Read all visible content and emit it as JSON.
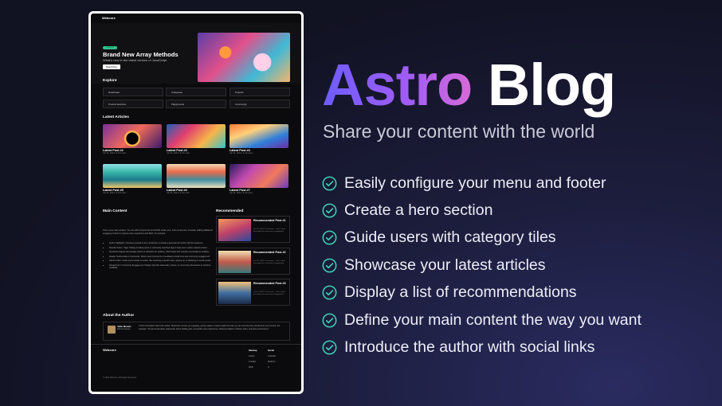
{
  "hero": {
    "title_part1": "Astro",
    "title_part2": "Blog",
    "subtitle": "Share your content with the world",
    "accent_gradient": [
      "#6d5cff",
      "#a35cf3",
      "#d66bd8"
    ],
    "check_color": "#3fd0b4"
  },
  "features": [
    "Easily configure your menu and footer",
    "Create a hero section",
    "Guide users with category tiles",
    "Showcase your latest articles",
    "Display a list of recommendations",
    "Define your main content the way you want",
    "Introduce the author with social links"
  ],
  "preview": {
    "site_name": "Webcore",
    "hero": {
      "badge": "Featured",
      "title": "Brand New Array Methods",
      "subtitle": "What's new in the latest version of JavaScript",
      "button": "Read More"
    },
    "explore": {
      "title": "Explore",
      "tiles": [
        "Roadmaps",
        "Categories",
        "Projects",
        "Product launches",
        "Playgrounds",
        "Community"
      ]
    },
    "latest": {
      "title": "Latest Articles",
      "posts": [
        {
          "title": "Latest Post #2",
          "meta": "Jan 01, 2024 • 5 min read"
        },
        {
          "title": "Latest Post #3",
          "meta": "Jan 01, 2024 • 5 min read"
        },
        {
          "title": "Latest Post #4",
          "meta": "Jan 01, 2024 • 4 min read"
        },
        {
          "title": "Latest Post #5",
          "meta": "Jan 01, 2024 • 5 min read"
        },
        {
          "title": "Latest Post #6",
          "meta": "Jan 01, 2024 • 4 min read"
        },
        {
          "title": "Latest Post #7",
          "meta": "Jan 01, 2024 • 5 min read"
        }
      ]
    },
    "main": {
      "title": "Main Content",
      "intro": "This is your main content. You can add components and HTML inside your .mdx component. Consider adding additional engaging content to improve user experience and SEO, for example:",
      "items": [
        "Author Highlights: Introduce yourself or key contributors to create a personal connection with the audience.",
        "Popular Topics / Tags: Display trending topics or commonly searched tags to help users explore related content.",
        "Newsletter Signup: Encourage visitors to subscribe for updates, which helps with retention and audience building.",
        "Reader Testimonials or Comments: Show recent comments or feedback to build trust and community engagement.",
        "Call-to-Action: Guide users toward an action, like exploring a specific topic, signing up, or following on social media.",
        "Social Proof / Community Engagement: Display stats like total reads, shares, or community discussions to reinforce credibility."
      ]
    },
    "recommended": {
      "title": "Recommended",
      "items": [
        {
          "title": "Recommended Post #1",
          "meta": "Jan 01, 2024 • 5 min read — Just a short description for some extra engagement."
        },
        {
          "title": "Recommended Post #2",
          "meta": "Jan 01, 2024 • 5 min read — Just a short description for some extra engagement."
        },
        {
          "title": "Recommended Post #3",
          "meta": "Jan 01, 2024 • 5 min read — Just a short description for some extra engagement."
        }
      ]
    },
    "author": {
      "title": "About the Author",
      "name": "John Brown",
      "role": "Web Developer",
      "bio": "A short description about the author. Should be concise yet engaging, giving readers a quick insight into who you are and why they should trust your content. For example: \"Frontend developer passionate about building fast, accessible web experiences. Sharing insights on React, Astro, and web performance.\""
    },
    "footer": {
      "logo": "Webcore",
      "col1": {
        "heading": "Sitemap",
        "links": [
          "Latest",
          "Contact",
          "RSS"
        ]
      },
      "col2": {
        "heading": "Social",
        "links": [
          "LinkedIn",
          "Medium",
          "X"
        ]
      },
      "copyright": "© 2024 Webcore. All Rights Reserved."
    }
  }
}
